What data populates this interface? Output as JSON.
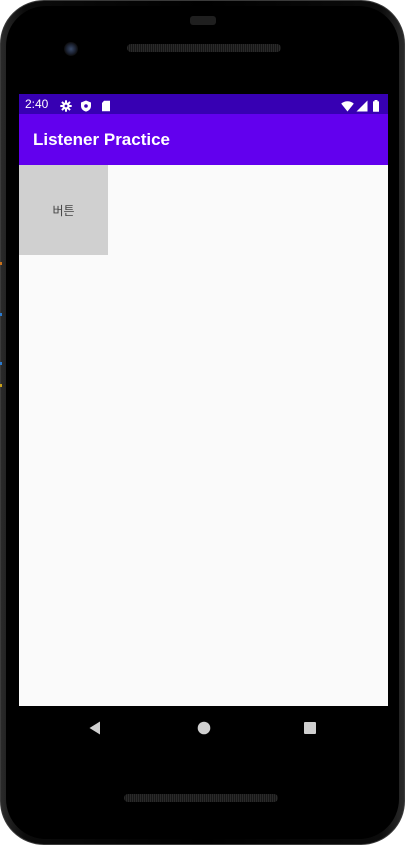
{
  "status_bar": {
    "time": "2:40",
    "background": "#3700b3",
    "icons": [
      "gear-icon",
      "shield-icon",
      "sd-card-icon",
      "wifi-icon",
      "signal-icon",
      "battery-icon"
    ]
  },
  "app_bar": {
    "title": "Listener Practice",
    "background": "#6200ee"
  },
  "content": {
    "button_label": "버튼",
    "button_color": "#d0d0d0",
    "background": "#fafafa"
  },
  "nav_bar": {
    "buttons": [
      "back-icon",
      "home-icon",
      "recents-icon"
    ]
  }
}
